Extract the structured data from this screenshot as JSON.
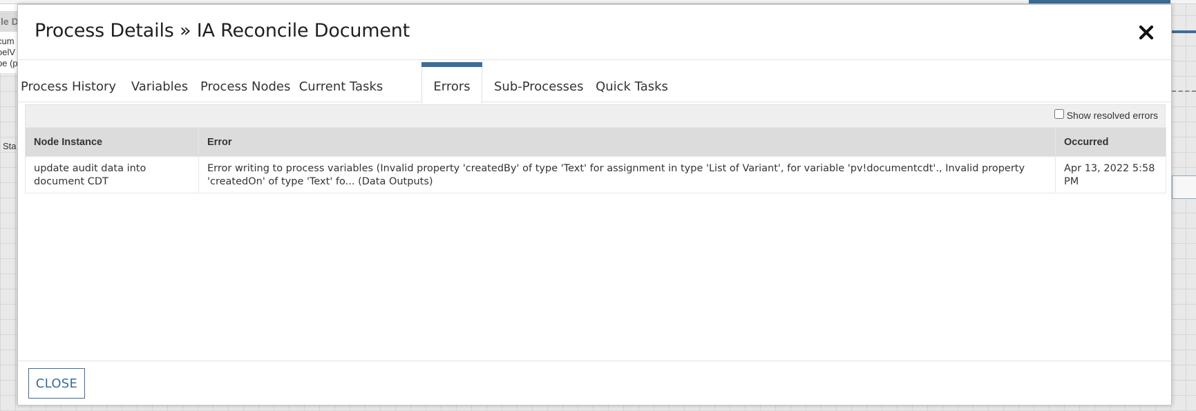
{
  "background": {
    "left_title_fragment": "le D",
    "left_lines": [
      "cum",
      "oelV",
      "pe (p"
    ],
    "left_label_fragment": "Sta"
  },
  "modal": {
    "title": "Process Details » IA Reconcile Document",
    "close_icon": "close-x-icon"
  },
  "tabs": [
    {
      "label": "Process History",
      "active": false
    },
    {
      "label": "Variables",
      "active": false
    },
    {
      "label": "Process Nodes",
      "active": false
    },
    {
      "label": "Current Tasks",
      "active": false
    },
    {
      "label": "Errors",
      "active": true
    },
    {
      "label": "Sub-Processes",
      "active": false
    },
    {
      "label": "Quick Tasks",
      "active": false
    }
  ],
  "toolbar": {
    "show_resolved_label": "Show resolved errors",
    "show_resolved_checked": false
  },
  "errors_table": {
    "columns": [
      "Node Instance",
      "Error",
      "Occurred"
    ],
    "rows": [
      {
        "node_instance": "update audit data into document CDT",
        "error": "Error writing to process variables (Invalid property 'createdBy' of type 'Text' for assignment in type 'List of Variant', for variable 'pv!documentcdt'., Invalid property 'createdOn' of type 'Text' fo... (Data Outputs)",
        "occurred": "Apr 13, 2022 5:58 PM"
      }
    ]
  },
  "footer": {
    "close_label": "CLOSE"
  },
  "colors": {
    "accent": "#3d6c99",
    "header_bg": "#dcdcdc",
    "toolbar_bg": "#efefef"
  }
}
